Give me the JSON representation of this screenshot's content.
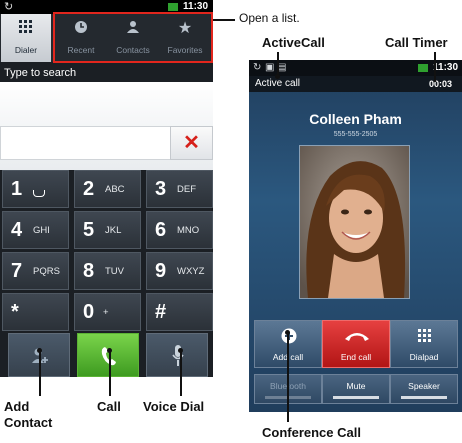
{
  "annotations": {
    "open_list": "Open a list.",
    "active_call": "ActiveCall",
    "call_timer": "Call Timer",
    "add_contact": "Add Contact",
    "call": "Call",
    "voice_dial": "Voice Dial",
    "conference_call": "Conference Call"
  },
  "dialer": {
    "status_time": "11:30",
    "tabs": [
      {
        "label": "Dialer",
        "icon": "keypad-icon",
        "active": true
      },
      {
        "label": "Recent",
        "icon": "clock-icon"
      },
      {
        "label": "Contacts",
        "icon": "person-icon"
      },
      {
        "label": "Favorites",
        "icon": "star-icon"
      }
    ],
    "search_placeholder": "Type to search",
    "keys": [
      {
        "digit": "1",
        "letters": ""
      },
      {
        "digit": "2",
        "letters": "ABC"
      },
      {
        "digit": "3",
        "letters": "DEF"
      },
      {
        "digit": "4",
        "letters": "GHI"
      },
      {
        "digit": "5",
        "letters": "JKL"
      },
      {
        "digit": "6",
        "letters": "MNO"
      },
      {
        "digit": "7",
        "letters": "PQRS"
      },
      {
        "digit": "8",
        "letters": "TUV"
      },
      {
        "digit": "9",
        "letters": "WXYZ"
      },
      {
        "digit": "*",
        "letters": ""
      },
      {
        "digit": "0",
        "letters": "+"
      },
      {
        "digit": "#",
        "letters": ""
      }
    ]
  },
  "call": {
    "status_time": "11:30",
    "header_title": "Active call",
    "timer": "00:03",
    "contact_name": "Colleen Pham",
    "contact_number": "555-555-2505",
    "buttons": {
      "add_call": "Add call",
      "end_call": "End call",
      "dialpad": "Dialpad",
      "bluetooth": "Bluetooth",
      "mute": "Mute",
      "speaker": "Speaker"
    }
  },
  "colors": {
    "highlight": "#e2261d",
    "end_call": "#c91f1f",
    "call_green": "#4fae2a"
  }
}
